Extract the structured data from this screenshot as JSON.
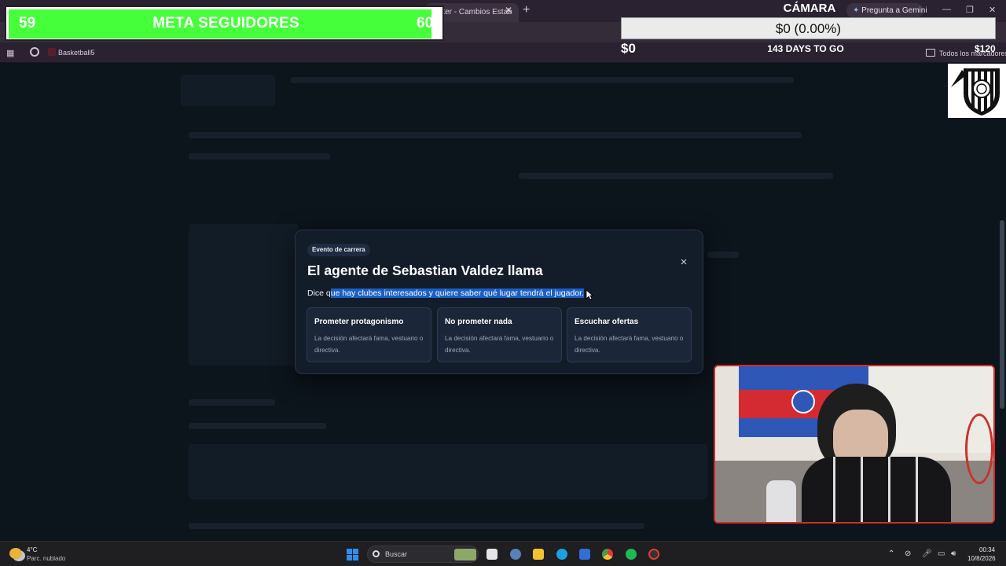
{
  "browser": {
    "active_tab_title": "...ster - Cambios Estab",
    "tab_close_glyph": "✕",
    "new_tab_glyph": "+",
    "gemini_label": "Pregunta a Gemini",
    "bookmark_label": "Basketball5",
    "all_bookmarks_label": "Todos los marcadores"
  },
  "follower_goal": {
    "current": "59",
    "title": "META SEGUIDORES",
    "target": "60",
    "progress_fraction": 0.98,
    "bar_color": "#45ff3a"
  },
  "camera_goal": {
    "title": "CÁMARA",
    "progress_text": "$0 (0.00%)",
    "current_amount": "$0",
    "days_left": "143 DAYS TO GO",
    "target_amount": "$120"
  },
  "modal": {
    "badge": "Evento de carrera",
    "title": "El agente de Sebastian Valdez llama",
    "description_prefix": "Dice q",
    "description_selected": "ue hay clubes interesados y quiere saber qué lugar tendrá el jugador.",
    "close_glyph": "×",
    "options": [
      {
        "title": "Prometer protagonismo",
        "desc": "La decisión afectará fama, vestuario o directiva."
      },
      {
        "title": "No prometer nada",
        "desc": "La decisión afectará fama, vestuario o directiva."
      },
      {
        "title": "Escuchar ofertas",
        "desc": "La decisión afectará fama, vestuario o directiva."
      }
    ]
  },
  "taskbar": {
    "weather_temp": "4°C",
    "weather_desc": "Parc. nublado",
    "search_placeholder": "Buscar",
    "time": "00:34",
    "date": "10/8/2026"
  },
  "colors": {
    "selection": "#1a5fc8",
    "modal_bg": "#131d2a",
    "webcam_border": "#d52a2a"
  }
}
